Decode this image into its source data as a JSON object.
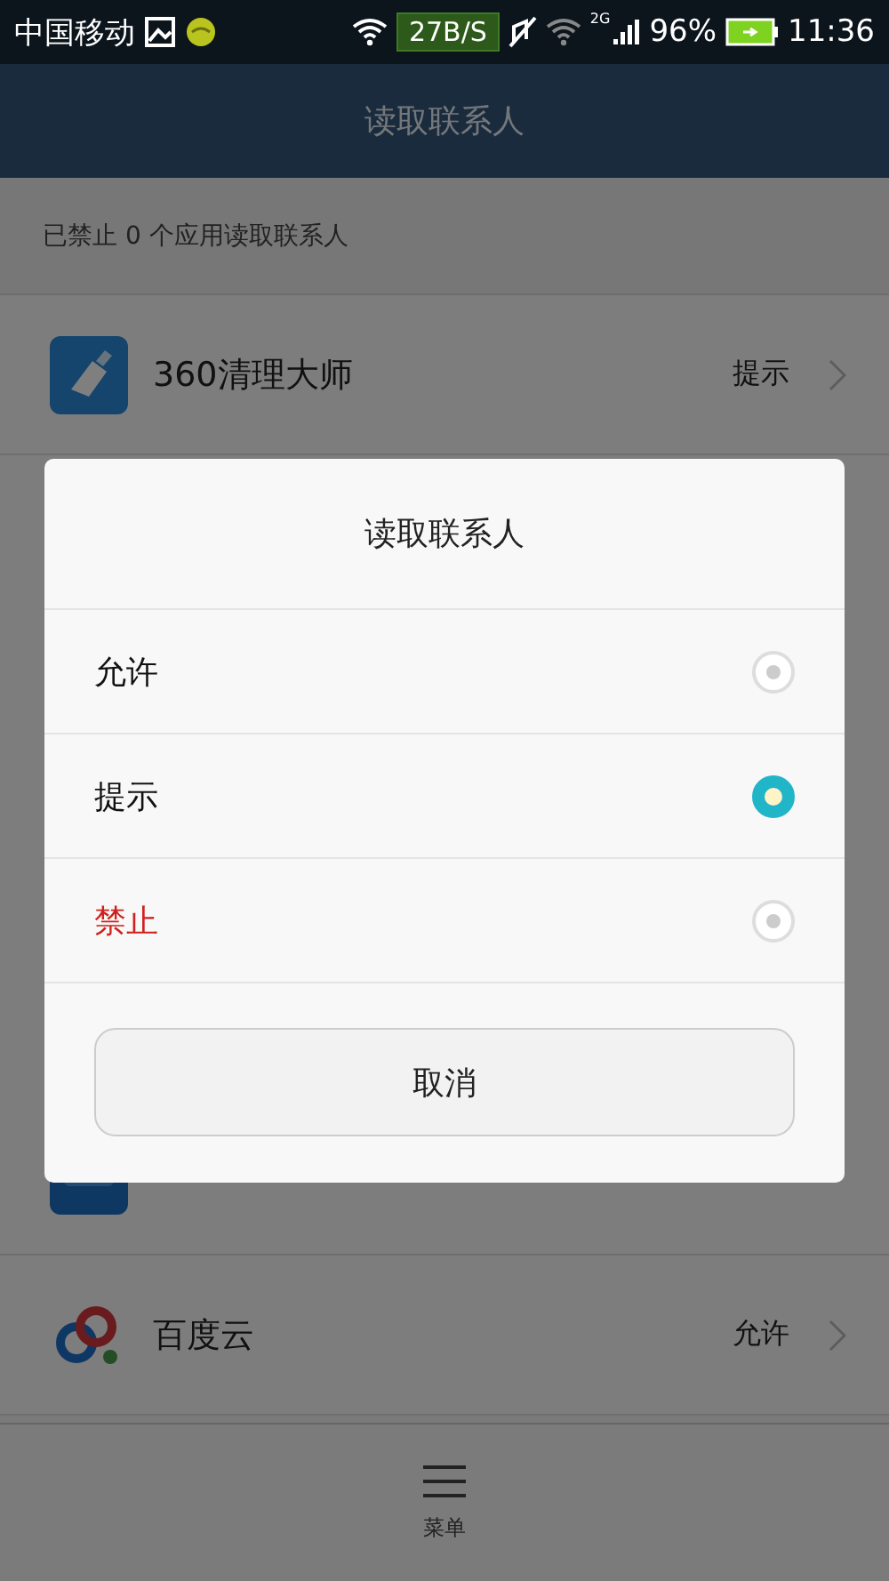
{
  "status_bar": {
    "carrier": "中国移动",
    "speed": "27B/S",
    "network": "2G",
    "battery": "96%",
    "time": "11:36"
  },
  "header": {
    "title": "读取联系人"
  },
  "summary": "已禁止 0 个应用读取联系人",
  "apps": [
    {
      "kind": "broom",
      "name": "360清理大师",
      "permission": "提示"
    },
    {
      "kind": "tile"
    },
    {
      "kind": "cloud",
      "name": "百度云",
      "permission": "允许"
    }
  ],
  "dialog": {
    "title": "读取联系人",
    "options": [
      {
        "label": "允许",
        "selected": false,
        "kind": "normal"
      },
      {
        "label": "提示",
        "selected": true,
        "kind": "normal"
      },
      {
        "label": "禁止",
        "selected": false,
        "kind": "danger"
      }
    ],
    "cancel": "取消"
  },
  "bottom_bar": {
    "menu": "菜单"
  }
}
